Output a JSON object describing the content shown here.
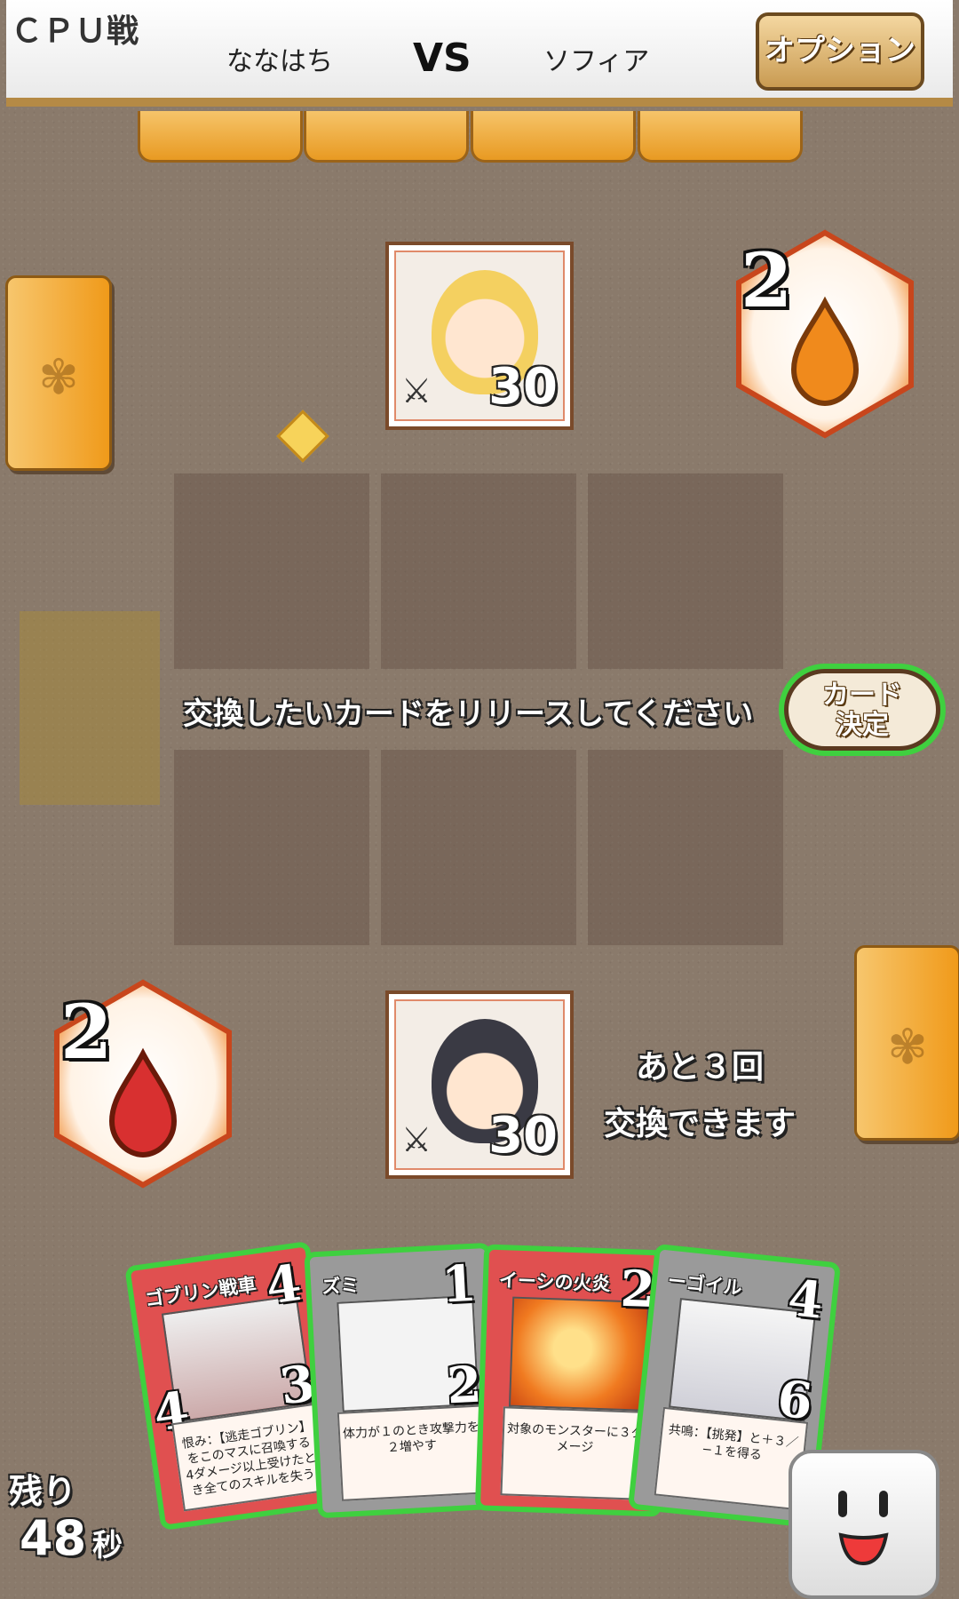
{
  "header": {
    "mode": "ＣＰＵ戦",
    "player_left": "ななはち",
    "vs": "VS",
    "player_right": "ソフィア",
    "option_label": "オプション"
  },
  "opponent": {
    "hp": "30",
    "mana": "2",
    "mana_color": "#f08a1c"
  },
  "player": {
    "hp": "30",
    "mana": "2",
    "mana_color": "#d83030"
  },
  "board": {
    "prompt": "交換したいカードをリリースしてください",
    "decide_label_1": "カード",
    "decide_label_2": "決定",
    "swap_info_1": "あと３回",
    "swap_info_2": "交換できます"
  },
  "hand": [
    {
      "title": "ゴブリン戦車",
      "cost": "4",
      "attack": "4",
      "hp": "3",
      "text": "恨み：【逃走ゴブリン】をこのマスに召喚する　4ダメージ以上受けたとき全てのスキルを失う",
      "color": "#e05050",
      "icon": "goblin-chariot-art"
    },
    {
      "title": "ズミ",
      "cost": "1",
      "attack": "",
      "hp": "2",
      "text": "体力が１のとき攻撃力を２増やす",
      "color": "#9a9a9a",
      "icon": "rat-art"
    },
    {
      "title": "イーシの火炎",
      "cost": "2",
      "attack": "",
      "hp": "",
      "text": "対象のモンスターに３ダメージ",
      "color": "#e05050",
      "icon": "fire-mage-art"
    },
    {
      "title": "ーゴイル",
      "cost": "4",
      "attack": "",
      "hp": "6",
      "text": "共鳴：【挑発】と＋３／−１を得る",
      "color": "#9a9a9a",
      "icon": "gargoyle-art"
    }
  ],
  "timer": {
    "label": "残り",
    "value": "48",
    "unit": "秒"
  },
  "icons": {
    "deck_emblem": "wing-emblem-icon",
    "emote": "smiley-face-icon",
    "mana": "gem-drop-icon"
  }
}
